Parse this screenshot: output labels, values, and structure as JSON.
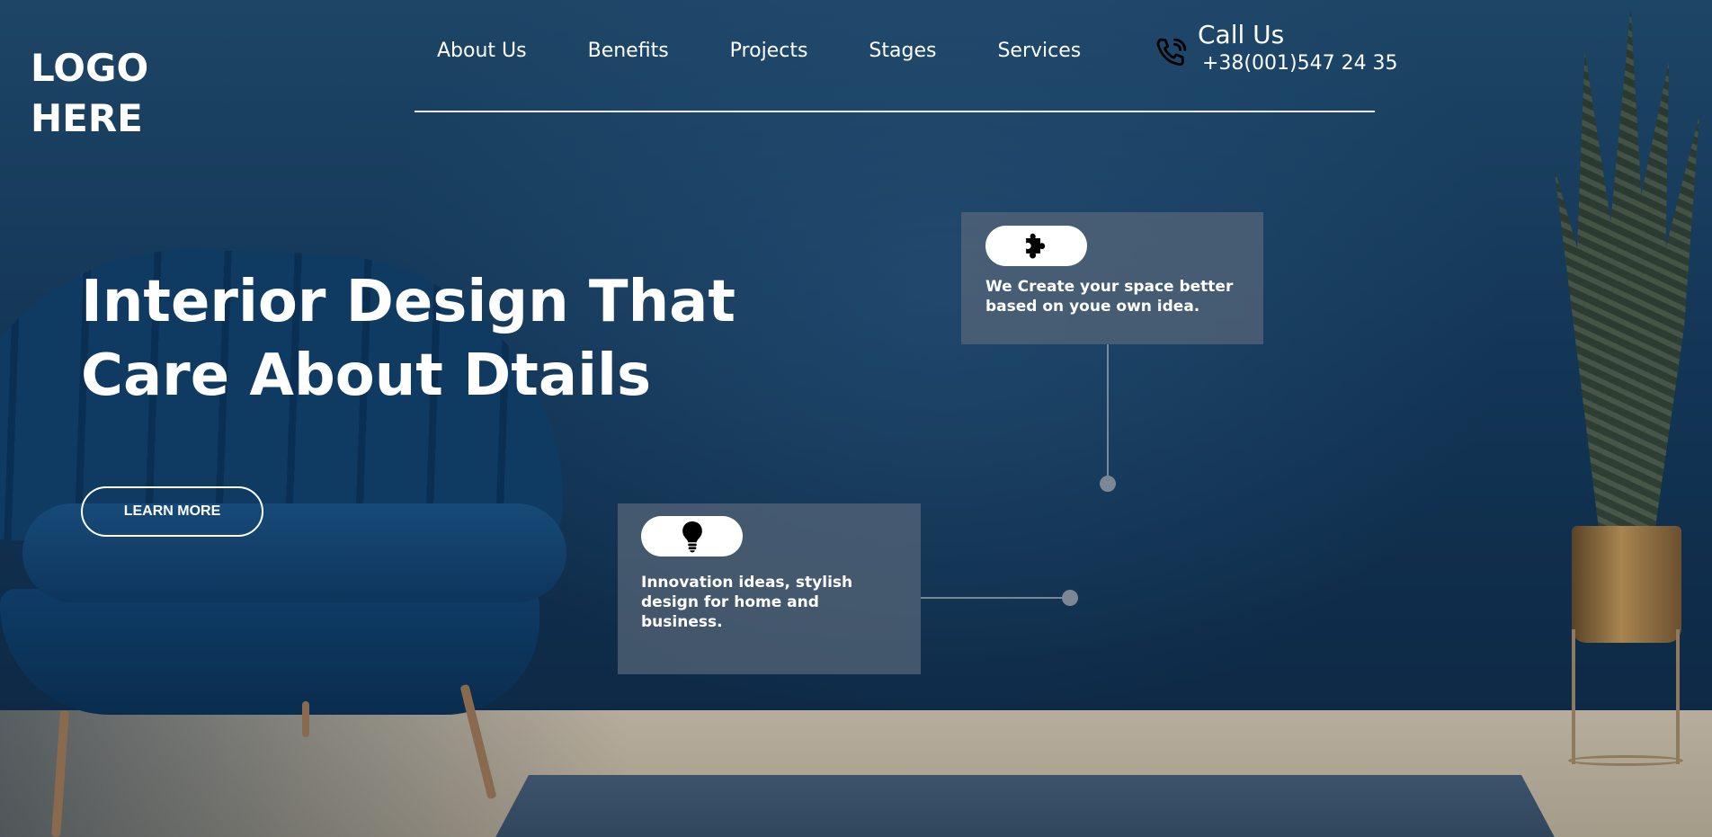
{
  "logo": {
    "line1": "LOGO",
    "line2": "HERE"
  },
  "nav": {
    "items": [
      {
        "label": "About Us"
      },
      {
        "label": "Benefits"
      },
      {
        "label": "Projects"
      },
      {
        "label": "Stages"
      },
      {
        "label": "Services"
      }
    ]
  },
  "contact": {
    "title": "Call Us",
    "phone": "+38(001)547 24 35",
    "icon": "phone-icon"
  },
  "hero": {
    "heading_line1": "Interior Design That",
    "heading_line2": "Care About Dtails",
    "cta_label": "LEARN MORE"
  },
  "cards": [
    {
      "icon": "puzzle-icon",
      "text": "We Create your space better based on youe own idea."
    },
    {
      "icon": "lightbulb-icon",
      "text": "Innovation ideas, stylish design for home and business."
    }
  ],
  "colors": {
    "background": "#13314f",
    "card": "#586678",
    "text": "#ffffff"
  }
}
